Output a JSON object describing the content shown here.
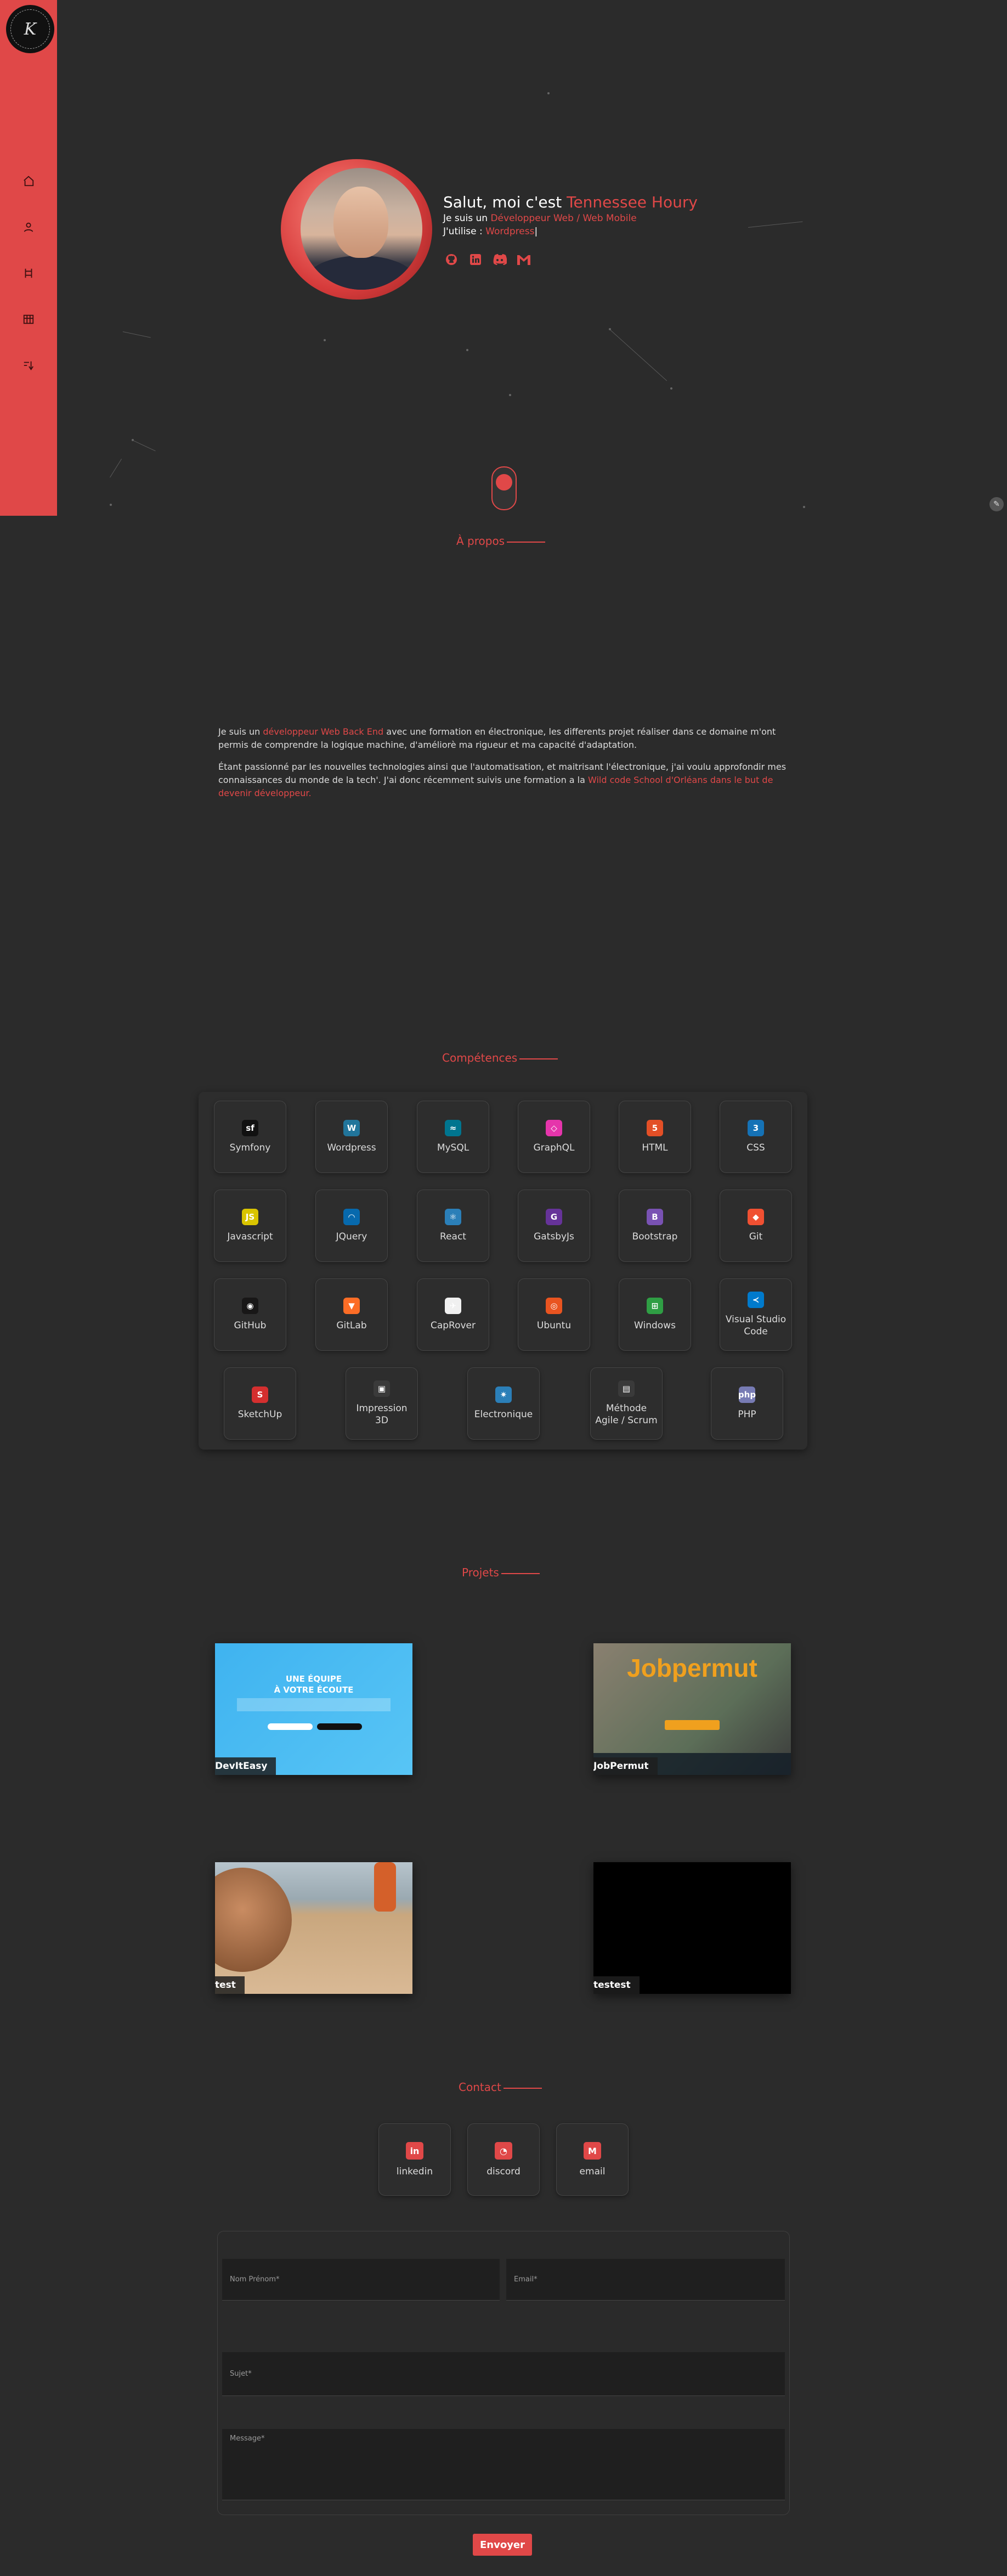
{
  "sidebar": {
    "logo_text": "K",
    "items": [
      {
        "icon": "home-icon",
        "glyph": "⌂"
      },
      {
        "icon": "user-icon",
        "glyph": "👤"
      },
      {
        "icon": "skills-icon",
        "glyph": "⚙"
      },
      {
        "icon": "projects-icon",
        "glyph": "▦"
      },
      {
        "icon": "contact-icon",
        "glyph": "✉"
      }
    ]
  },
  "hero": {
    "greeting": "Salut, moi c'est ",
    "name": "Tennessee Houry",
    "role_prefix": "Je suis un ",
    "role": "Développeur Web / Web Mobile",
    "uses_prefix": "J'utilise : ",
    "uses": "Wordpress",
    "cursor": "|",
    "social": [
      {
        "icon": "github-icon",
        "glyph": "◉"
      },
      {
        "icon": "linkedin-icon",
        "glyph": "in"
      },
      {
        "icon": "discord-icon",
        "glyph": "◔"
      },
      {
        "icon": "gmail-icon",
        "glyph": "M"
      }
    ]
  },
  "about": {
    "title": "À propos",
    "p1_a": "Je suis un ",
    "p1_b": "développeur Web Back End",
    "p1_c": " avec une formation en électronique, les differents projet réaliser dans ce domaine m'ont permis de comprendre la logique machine, d'améliorè ma rigueur et ma capacité d'adaptation.",
    "p2_a": "Étant passionné par les nouvelles technologies ainsi que l'automatisation, et maitrisant l'électronique, j'ai voulu approfondir mes connaissances du monde de la tech'. J'ai donc récemment suivis une formation a la ",
    "p2_b": "Wild code School d'Orléans dans le but de devenir développeur."
  },
  "skills": {
    "title": "Compétences",
    "items": [
      {
        "label": "Symfony",
        "icon": "symfony-icon",
        "glyph": "sf",
        "color": "#111111"
      },
      {
        "label": "Wordpress",
        "icon": "wordpress-icon",
        "glyph": "W",
        "color": "#21759b"
      },
      {
        "label": "MySQL",
        "icon": "mysql-icon",
        "glyph": "≈",
        "color": "#00758f"
      },
      {
        "label": "GraphQL",
        "icon": "graphql-icon",
        "glyph": "◇",
        "color": "#e535ab"
      },
      {
        "label": "HTML",
        "icon": "html-icon",
        "glyph": "5",
        "color": "#e34f26"
      },
      {
        "label": "CSS",
        "icon": "css-icon",
        "glyph": "3",
        "color": "#1572b6"
      },
      {
        "label": "Javascript",
        "icon": "javascript-icon",
        "glyph": "JS",
        "color": "#d9c400"
      },
      {
        "label": "JQuery",
        "icon": "jquery-icon",
        "glyph": "◠",
        "color": "#0769ad"
      },
      {
        "label": "React",
        "icon": "react-icon",
        "glyph": "⚛",
        "color": "#2b7fb8"
      },
      {
        "label": "GatsbyJs",
        "icon": "gatsby-icon",
        "glyph": "G",
        "color": "#663399"
      },
      {
        "label": "Bootstrap",
        "icon": "bootstrap-icon",
        "glyph": "B",
        "color": "#7952b3"
      },
      {
        "label": "Git",
        "icon": "git-icon",
        "glyph": "◆",
        "color": "#f05032"
      },
      {
        "label": "GitHub",
        "icon": "github-icon",
        "glyph": "◉",
        "color": "#181717"
      },
      {
        "label": "GitLab",
        "icon": "gitlab-icon",
        "glyph": "▼",
        "color": "#fc6d26"
      },
      {
        "label": "CapRover",
        "icon": "caprover-icon",
        "glyph": "✈",
        "color": "#f0f0f0"
      },
      {
        "label": "Ubuntu",
        "icon": "ubuntu-icon",
        "glyph": "◎",
        "color": "#e95420"
      },
      {
        "label": "Windows",
        "icon": "windows-icon",
        "glyph": "⊞",
        "color": "#2f9e44"
      },
      {
        "label": "Visual Studio Code",
        "icon": "vscode-icon",
        "glyph": "≺",
        "color": "#007acc"
      },
      {
        "label": "SketchUp",
        "icon": "sketchup-icon",
        "glyph": "S",
        "color": "#d42f2f"
      },
      {
        "label": "Impression 3D",
        "icon": "printer-3d-icon",
        "glyph": "▣",
        "color": "#3a3a3a"
      },
      {
        "label": "Electronique",
        "icon": "electronics-icon",
        "glyph": "✷",
        "color": "#2b7fb8"
      },
      {
        "label": "Méthode Agile / Scrum",
        "icon": "scrum-icon",
        "glyph": "▤",
        "color": "#3a3a3a"
      },
      {
        "label": "PHP",
        "icon": "php-icon",
        "glyph": "php",
        "color": "#777bb4"
      }
    ]
  },
  "projects": {
    "title": "Projets",
    "items": [
      {
        "label": "DevItEasy",
        "icon": "deviteasy-thumbnail",
        "banner": "UNE ÉQUIPE",
        "banner2": "À VOTRE ÉCOUTE"
      },
      {
        "label": "JobPermut",
        "icon": "jobpermut-thumbnail",
        "banner": "Jobpermut"
      },
      {
        "label": "test",
        "icon": "beach-thumbnail"
      },
      {
        "label": "testest",
        "icon": "black-thumbnail"
      }
    ]
  },
  "contact": {
    "title": "Contact",
    "cards": [
      {
        "label": "linkedin",
        "icon": "linkedin-icon",
        "glyph": "in"
      },
      {
        "label": "discord",
        "icon": "discord-icon",
        "glyph": "◔"
      },
      {
        "label": "email",
        "icon": "gmail-icon",
        "glyph": "M"
      }
    ],
    "form": {
      "name_placeholder": "Nom Prénom*",
      "email_placeholder": "Email*",
      "subject_placeholder": "Sujet*",
      "message_placeholder": "Message*",
      "submit": "Envoyer"
    }
  },
  "colors": {
    "accent": "#e04848",
    "background": "#2b2b2b"
  }
}
